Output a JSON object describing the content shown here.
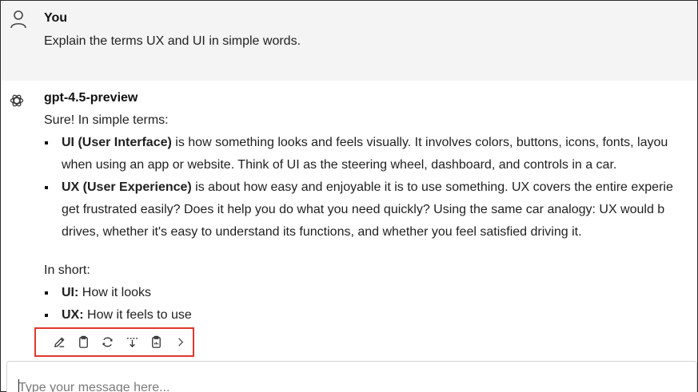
{
  "user_message": {
    "sender": "You",
    "text": "Explain the terms UX and UI in simple words."
  },
  "assistant_message": {
    "sender": "gpt-4.5-preview",
    "intro": "Sure! In simple terms:",
    "bullets": [
      {
        "term": "UI (User Interface)",
        "line1": " is how something looks and feels visually. It involves colors, buttons, icons, fonts, layou",
        "line2": "when using an app or website. Think of UI as the steering wheel, dashboard, and controls in a car."
      },
      {
        "term": "UX (User Experience)",
        "line1": " is about how easy and enjoyable it is to use something. UX covers the entire experie",
        "line2": "get frustrated easily? Does it help you do what you need quickly? Using the same car analogy: UX would b",
        "line3": "drives, whether it's easy to understand its functions, and whether you feel satisfied driving it."
      }
    ],
    "summary_label": "In short:",
    "summary": [
      {
        "term": "UI:",
        "text": " How it looks"
      },
      {
        "term": "UX:",
        "text": " How it feels to use"
      }
    ]
  },
  "toolbar": {
    "icons": [
      "edit-icon",
      "copy-icon",
      "regenerate-icon",
      "insert-below-icon",
      "clipboard-icon",
      "chevron-right-icon"
    ],
    "highlight_color": "#e0382e"
  },
  "composer": {
    "placeholder": "Type your message here..."
  }
}
